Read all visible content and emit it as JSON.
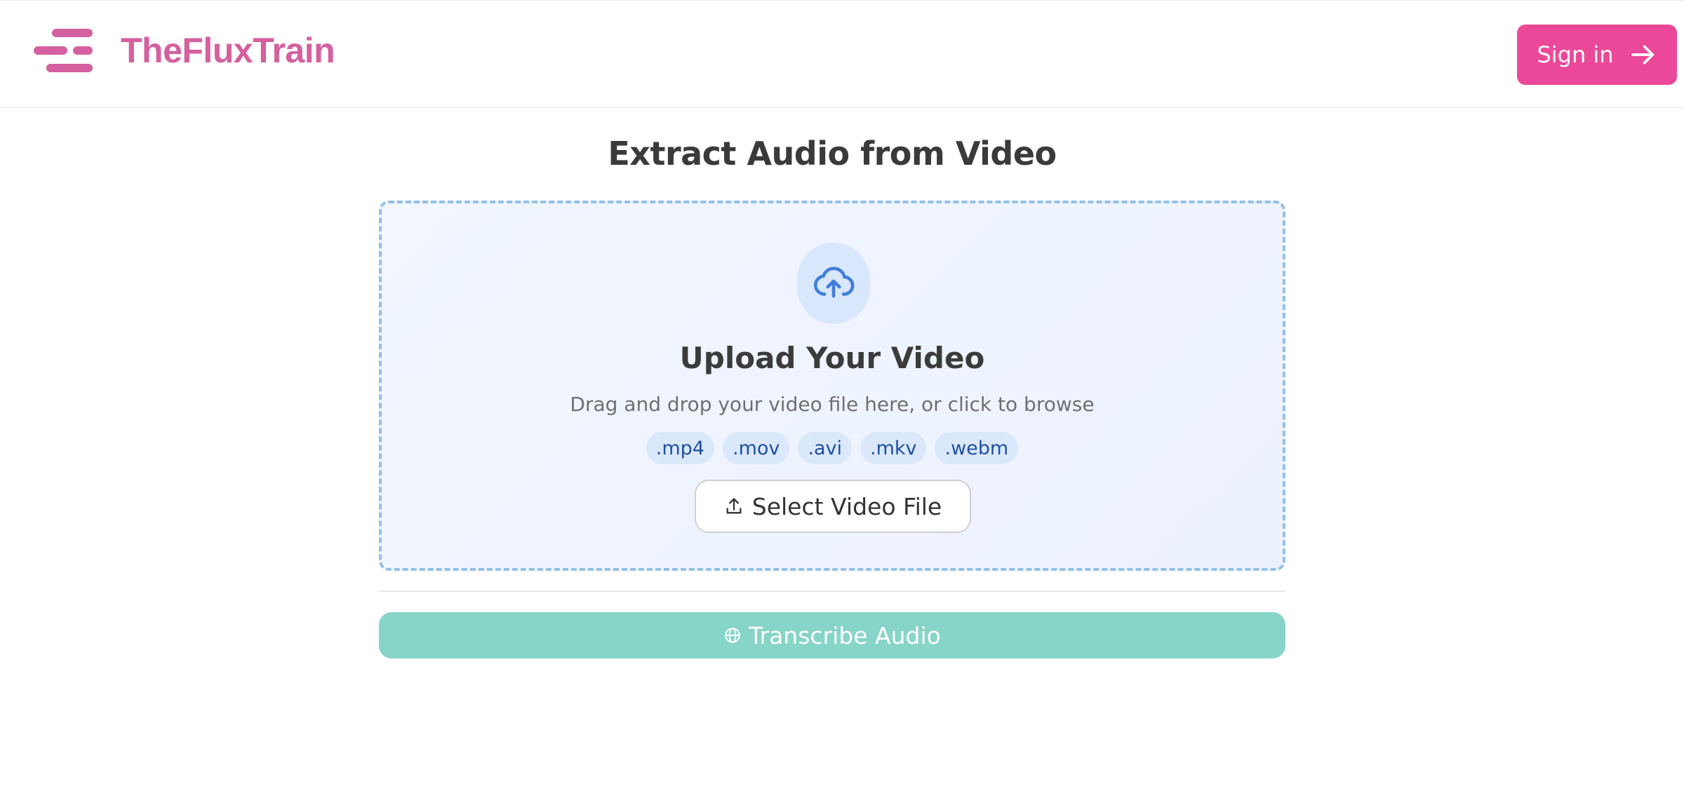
{
  "header": {
    "brand": "TheFluxTrain",
    "sign_in_label": "Sign in",
    "logo_icon": "lines-logo-icon",
    "sign_in_icon": "arrow-right-icon"
  },
  "main": {
    "title": "Extract Audio from Video",
    "upload": {
      "icon": "cloud-upload-icon",
      "title": "Upload Your Video",
      "subtitle": "Drag and drop your video file here, or click to browse",
      "formats": [
        ".mp4",
        ".mov",
        ".avi",
        ".mkv",
        ".webm"
      ],
      "select_icon": "upload-icon",
      "select_label": "Select Video File"
    },
    "transcribe": {
      "icon": "globe-icon",
      "label": "Transcribe Audio"
    }
  },
  "colors": {
    "brand": "#d4609f",
    "sign_in_bg": "#ec4899",
    "dropzone_border": "#93c0e8",
    "format_chip_bg": "#dbe8fb",
    "transcribe_bg": "#87d4c8"
  }
}
